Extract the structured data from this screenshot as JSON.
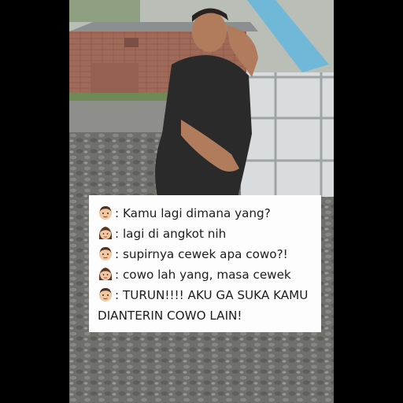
{
  "chat": {
    "messages": [
      {
        "speaker": "guy",
        "icon": "man-face-icon",
        "text": ": Kamu lagi dimana yang?"
      },
      {
        "speaker": "girl",
        "icon": "woman-face-icon",
        "text": ": lagi di angkot nih"
      },
      {
        "speaker": "guy",
        "icon": "man-face-icon",
        "text": ": supirnya cewek apa cowo?!"
      },
      {
        "speaker": "girl",
        "icon": "woman-face-icon",
        "text": ": cowo lah yang, masa cewek"
      },
      {
        "speaker": "guy",
        "icon": "man-face-icon",
        "text": ": TURUN!!!! AKU GA SUKA KAMU"
      }
    ],
    "continuation": "DIANTERIN COWO LAIN!"
  },
  "colors": {
    "letterbox": "#000000",
    "card": "#fdfdfd",
    "text": "#1c1c1c",
    "shirt": "#2a2a2a",
    "gravel": "#6f6f6c"
  }
}
